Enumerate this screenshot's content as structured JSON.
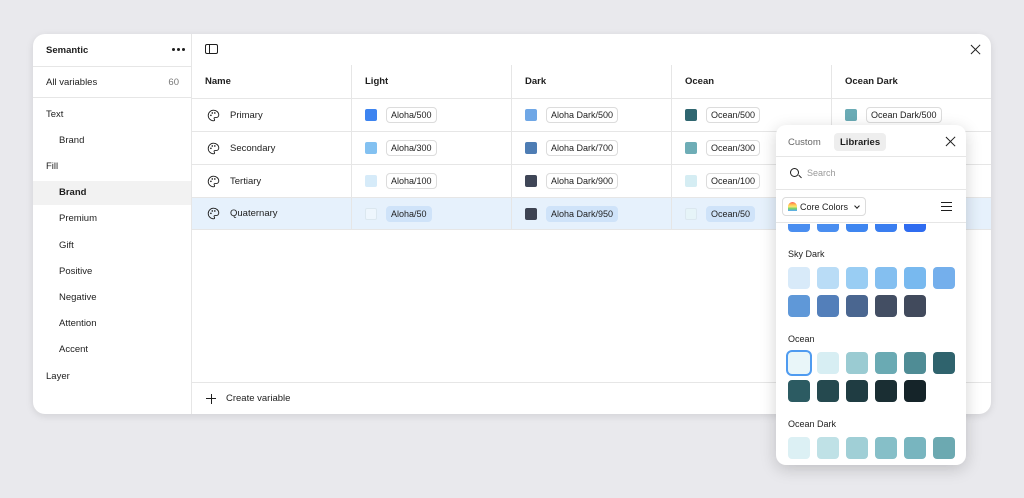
{
  "sidebar": {
    "title": "Semantic",
    "all_variables": "All variables",
    "count": "60",
    "items": [
      {
        "label": "Text",
        "level": 0
      },
      {
        "label": "Brand",
        "level": 1
      },
      {
        "label": "Fill",
        "level": 0
      },
      {
        "label": "Brand",
        "level": 1,
        "active": true
      },
      {
        "label": "Premium",
        "level": 1
      },
      {
        "label": "Gift",
        "level": 1
      },
      {
        "label": "Positive",
        "level": 1
      },
      {
        "label": "Negative",
        "level": 1
      },
      {
        "label": "Attention",
        "level": 1
      },
      {
        "label": "Accent",
        "level": 1
      },
      {
        "label": "Layer",
        "level": 0
      }
    ]
  },
  "table": {
    "columns": [
      "Name",
      "Light",
      "Dark",
      "Ocean",
      "Ocean Dark"
    ],
    "rows": [
      {
        "name": "Primary",
        "values": [
          {
            "label": "Aloha/500",
            "color": "#3d84f0"
          },
          {
            "label": "Aloha Dark/500",
            "color": "#6fa7e6"
          },
          {
            "label": "Ocean/500",
            "color": "#2f6670"
          },
          {
            "label": "Ocean Dark/500",
            "color": "#6aabb5"
          }
        ]
      },
      {
        "name": "Secondary",
        "values": [
          {
            "label": "Aloha/300",
            "color": "#83c1f1"
          },
          {
            "label": "Aloha Dark/700",
            "color": "#4e7db4"
          },
          {
            "label": "Ocean/300",
            "color": "#6eadb6"
          },
          {
            "label": "",
            "color": ""
          }
        ]
      },
      {
        "name": "Tertiary",
        "values": [
          {
            "label": "Aloha/100",
            "color": "#d6ebf9"
          },
          {
            "label": "Aloha Dark/900",
            "color": "#3f4657"
          },
          {
            "label": "Ocean/100",
            "color": "#d5edf3"
          },
          {
            "label": "",
            "color": ""
          }
        ]
      },
      {
        "name": "Quaternary",
        "selected": true,
        "values": [
          {
            "label": "Aloha/50",
            "color": "#eef6fd"
          },
          {
            "label": "Aloha Dark/950",
            "color": "#3d4352"
          },
          {
            "label": "Ocean/50",
            "color": "#e6f4f8"
          },
          {
            "label": "",
            "color": ""
          }
        ]
      }
    ]
  },
  "footer": {
    "create_label": "Create variable"
  },
  "popover": {
    "tabs": [
      "Custom",
      "Libraries"
    ],
    "active_tab": "Libraries",
    "search_placeholder": "Search",
    "library_label": "Core Colors",
    "groups": [
      {
        "label": "",
        "rows": [
          [
            "#4a8ef0",
            "#4a8ef0",
            "#3f86f0",
            "#3a7ef0",
            "#2f6cf0"
          ]
        ]
      },
      {
        "label": "Sky Dark",
        "rows": [
          [
            "#d8eaf9",
            "#b9dcf6",
            "#99cdf3",
            "#84bff0",
            "#78b9ef",
            "#74afec"
          ],
          [
            "#5f98d8",
            "#537fba",
            "#4a6690",
            "#434e63",
            "#414a5c"
          ]
        ]
      },
      {
        "label": "Ocean",
        "rows": [
          [
            "#e9f6f9",
            "#d7eef3",
            "#9acbd2",
            "#6aaab3",
            "#4f8c95",
            "#2f636d"
          ],
          [
            "#2c5b62",
            "#25494f",
            "#1f3c42",
            "#1a2e33",
            "#152429"
          ]
        ]
      },
      {
        "label": "Ocean Dark",
        "rows": [
          [
            "#dcf0f4",
            "#bfe1e6",
            "#a0cfd6",
            "#86bfc8",
            "#78b5bf",
            "#6ca9b1"
          ]
        ]
      }
    ]
  }
}
